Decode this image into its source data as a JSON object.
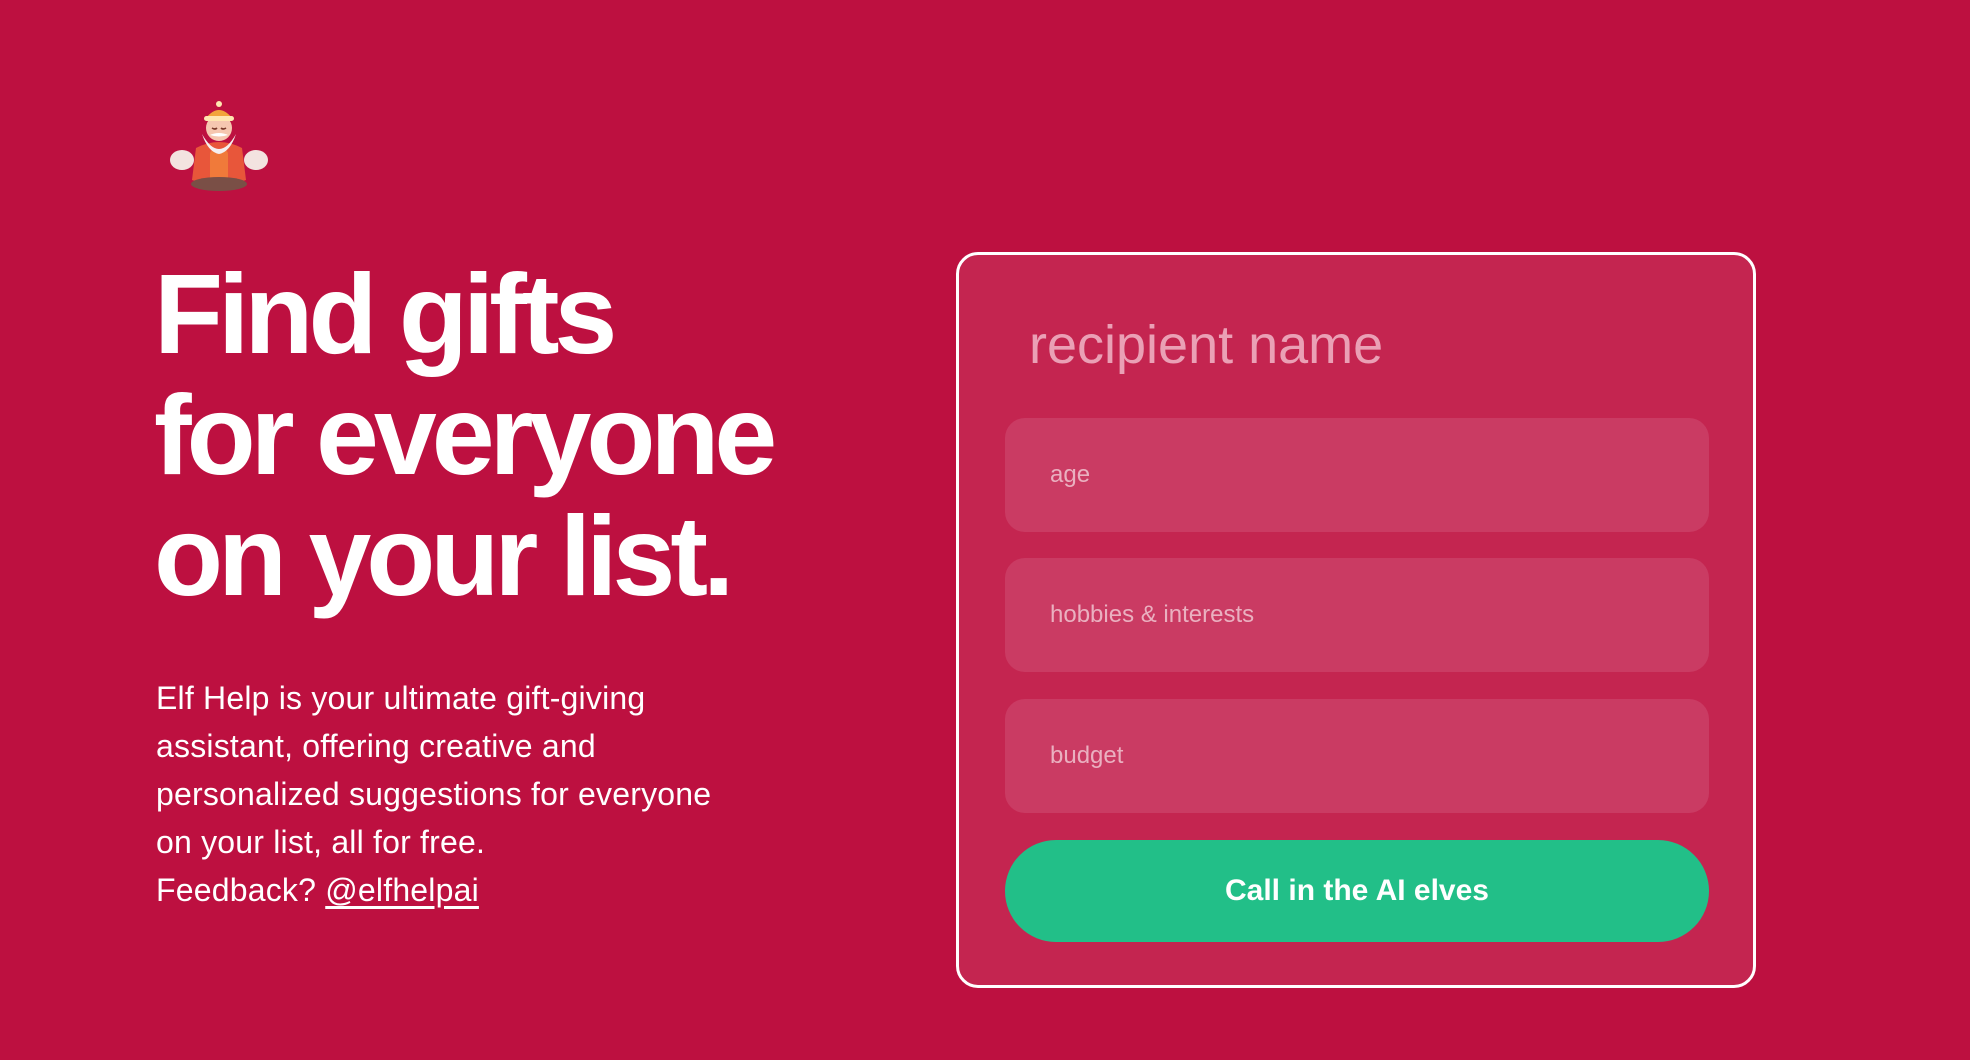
{
  "brand": {
    "logo_icon": "elf-santa-meditating-icon"
  },
  "hero": {
    "headline_lines": [
      "Find gifts",
      "for everyone",
      "on your list."
    ],
    "description_lines": [
      "Elf Help is your ultimate gift-giving",
      "assistant, offering creative and",
      "personalized suggestions for everyone",
      "on your list, all for free."
    ],
    "feedback_label": "Feedback?",
    "feedback_link": "@elfhelpai"
  },
  "form": {
    "name_placeholder": "recipient name",
    "age_placeholder": "age",
    "hobbies_placeholder": "hobbies & interests",
    "budget_placeholder": "budget",
    "submit_label": "Call in the AI elves"
  },
  "colors": {
    "background": "#bd1040",
    "card": "#c42550",
    "field": "#ca3b63",
    "accent_button": "#22bf88",
    "text": "#ffffff"
  }
}
